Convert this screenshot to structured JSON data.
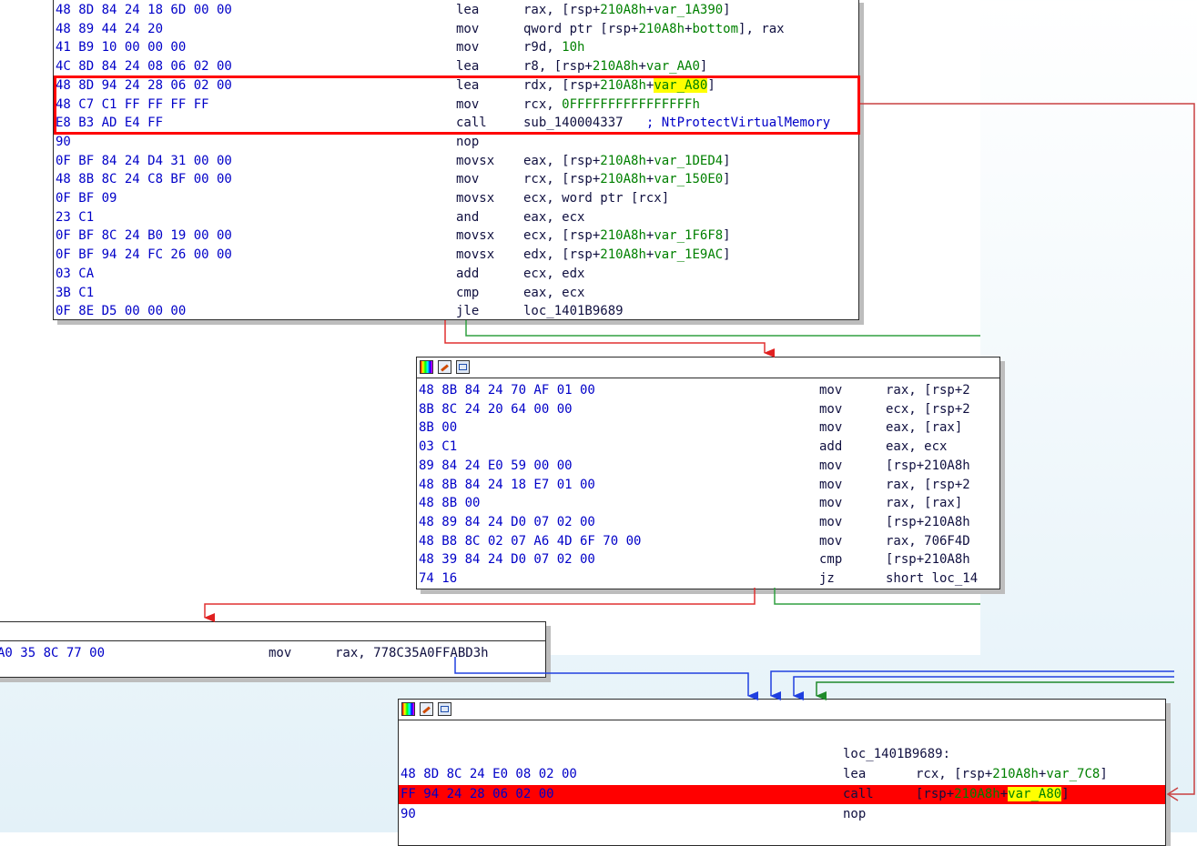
{
  "node1": {
    "lines": [
      {
        "bytes": "48 8D 84 24 18 6D 00 00",
        "mnem": "lea",
        "ops": [
          {
            "t": "rax, [rsp+"
          },
          {
            "t": "210A8h",
            "c": "g"
          },
          {
            "t": "+"
          },
          {
            "t": "var_1A390",
            "c": "g"
          },
          {
            "t": "]"
          }
        ]
      },
      {
        "bytes": "48 89 44 24 20",
        "mnem": "mov",
        "ops": [
          {
            "t": "qword ptr [rsp+"
          },
          {
            "t": "210A8h",
            "c": "g"
          },
          {
            "t": "+"
          },
          {
            "t": "bottom",
            "c": "g"
          },
          {
            "t": "], rax"
          }
        ]
      },
      {
        "bytes": "41 B9 10 00 00 00",
        "mnem": "mov",
        "ops": [
          {
            "t": "r9d, "
          },
          {
            "t": "10h",
            "c": "g"
          }
        ]
      },
      {
        "bytes": "4C 8D 84 24 08 06 02 00",
        "mnem": "lea",
        "ops": [
          {
            "t": "r8, [rsp+"
          },
          {
            "t": "210A8h",
            "c": "g"
          },
          {
            "t": "+"
          },
          {
            "t": "var_AA0",
            "c": "g"
          },
          {
            "t": "]"
          }
        ]
      },
      {
        "bytes": "48 8D 94 24 28 06 02 00",
        "mnem": "lea",
        "ops": [
          {
            "t": "rdx, [rsp+"
          },
          {
            "t": "210A8h",
            "c": "g"
          },
          {
            "t": "+"
          },
          {
            "t": "var_A80",
            "c": "g",
            "hl": true
          },
          {
            "t": "]"
          }
        ]
      },
      {
        "bytes": "48 C7 C1 FF FF FF FF",
        "mnem": "mov",
        "ops": [
          {
            "t": "rcx, "
          },
          {
            "t": "0FFFFFFFFFFFFFFFFh",
            "c": "g"
          }
        ]
      },
      {
        "bytes": "E8 B3 AD E4 FF",
        "mnem": "call",
        "ops": [
          {
            "t": "sub_140004337"
          },
          {
            "t": "   ; NtProtectVirtualMemory",
            "c": "cm"
          }
        ]
      },
      {
        "bytes": "90",
        "mnem": "nop",
        "ops": []
      },
      {
        "bytes": "0F BF 84 24 D4 31 00 00",
        "mnem": "movsx",
        "ops": [
          {
            "t": "eax, [rsp+"
          },
          {
            "t": "210A8h",
            "c": "g"
          },
          {
            "t": "+"
          },
          {
            "t": "var_1DED4",
            "c": "g"
          },
          {
            "t": "]"
          }
        ]
      },
      {
        "bytes": "48 8B 8C 24 C8 BF 00 00",
        "mnem": "mov",
        "ops": [
          {
            "t": "rcx, [rsp+"
          },
          {
            "t": "210A8h",
            "c": "g"
          },
          {
            "t": "+"
          },
          {
            "t": "var_150E0",
            "c": "g"
          },
          {
            "t": "]"
          }
        ]
      },
      {
        "bytes": "0F BF 09",
        "mnem": "movsx",
        "ops": [
          {
            "t": "ecx, word ptr [rcx]"
          }
        ]
      },
      {
        "bytes": "23 C1",
        "mnem": "and",
        "ops": [
          {
            "t": "eax, ecx"
          }
        ]
      },
      {
        "bytes": "0F BF 8C 24 B0 19 00 00",
        "mnem": "movsx",
        "ops": [
          {
            "t": "ecx, [rsp+"
          },
          {
            "t": "210A8h",
            "c": "g"
          },
          {
            "t": "+"
          },
          {
            "t": "var_1F6F8",
            "c": "g"
          },
          {
            "t": "]"
          }
        ]
      },
      {
        "bytes": "0F BF 94 24 FC 26 00 00",
        "mnem": "movsx",
        "ops": [
          {
            "t": "edx, [rsp+"
          },
          {
            "t": "210A8h",
            "c": "g"
          },
          {
            "t": "+"
          },
          {
            "t": "var_1E9AC",
            "c": "g"
          },
          {
            "t": "]"
          }
        ]
      },
      {
        "bytes": "03 CA",
        "mnem": "add",
        "ops": [
          {
            "t": "ecx, edx"
          }
        ]
      },
      {
        "bytes": "3B C1",
        "mnem": "cmp",
        "ops": [
          {
            "t": "eax, ecx"
          }
        ]
      },
      {
        "bytes": "0F 8E D5 00 00 00",
        "mnem": "jle",
        "ops": [
          {
            "t": "loc_1401B9689"
          }
        ]
      }
    ]
  },
  "node2": {
    "lines": [
      {
        "bytes": "48 8B 84 24 70 AF 01 00",
        "mnem": "mov",
        "ops": [
          {
            "t": "rax, [rsp+2"
          }
        ]
      },
      {
        "bytes": "8B 8C 24 20 64 00 00",
        "mnem": "mov",
        "ops": [
          {
            "t": "ecx, [rsp+2"
          }
        ]
      },
      {
        "bytes": "8B 00",
        "mnem": "mov",
        "ops": [
          {
            "t": "eax, [rax]"
          }
        ]
      },
      {
        "bytes": "03 C1",
        "mnem": "add",
        "ops": [
          {
            "t": "eax, ecx"
          }
        ]
      },
      {
        "bytes": "89 84 24 E0 59 00 00",
        "mnem": "mov",
        "ops": [
          {
            "t": "[rsp+210A8h"
          }
        ]
      },
      {
        "bytes": "48 8B 84 24 18 E7 01 00",
        "mnem": "mov",
        "ops": [
          {
            "t": "rax, [rsp+2"
          }
        ]
      },
      {
        "bytes": "48 8B 00",
        "mnem": "mov",
        "ops": [
          {
            "t": "rax, [rax]"
          }
        ]
      },
      {
        "bytes": "48 89 84 24 D0 07 02 00",
        "mnem": "mov",
        "ops": [
          {
            "t": "[rsp+210A8h"
          }
        ]
      },
      {
        "bytes": "48 B8 8C 02 07 A6 4D 6F 70 00",
        "mnem": "mov",
        "ops": [
          {
            "t": "rax, 706F4D"
          }
        ]
      },
      {
        "bytes": "48 39 84 24 D0 07 02 00",
        "mnem": "cmp",
        "ops": [
          {
            "t": "[rsp+210A8h"
          }
        ]
      },
      {
        "bytes": "74 16",
        "mnem": "jz",
        "ops": [
          {
            "t": "short loc_14"
          }
        ]
      }
    ]
  },
  "node3": {
    "lines": [
      {
        "bytes": "A0 35 8C 77 00",
        "mnem": "mov",
        "ops": [
          {
            "t": "rax, 778C35A0FFABD3h"
          }
        ]
      }
    ]
  },
  "node4": {
    "label": "loc_1401B9689:",
    "lines": [
      {
        "bytes": "48 8D 8C 24 E0 08 02 00",
        "mnem": "lea",
        "ops": [
          {
            "t": "rcx, [rsp+"
          },
          {
            "t": "210A8h",
            "c": "g"
          },
          {
            "t": "+"
          },
          {
            "t": "var_7C8",
            "c": "g"
          },
          {
            "t": "]"
          }
        ]
      },
      {
        "bytes": "FF 94 24 28 06 02 00",
        "mnem": "call",
        "ops": [
          {
            "t": "[rsp+"
          },
          {
            "t": "210A8h",
            "c": "g"
          },
          {
            "t": "+"
          },
          {
            "t": "var_A80",
            "c": "g",
            "hl": true
          },
          {
            "t": "]"
          }
        ]
      },
      {
        "bytes": "90",
        "mnem": "nop",
        "ops": []
      }
    ]
  },
  "colors": {
    "bytes": "#0000c8",
    "operand_green": "#008000",
    "highlight": "#ffff00",
    "red_edge": "#e03030",
    "green_edge": "#30a040",
    "blue_edge": "#2040e0",
    "callout": "#ff0000"
  }
}
